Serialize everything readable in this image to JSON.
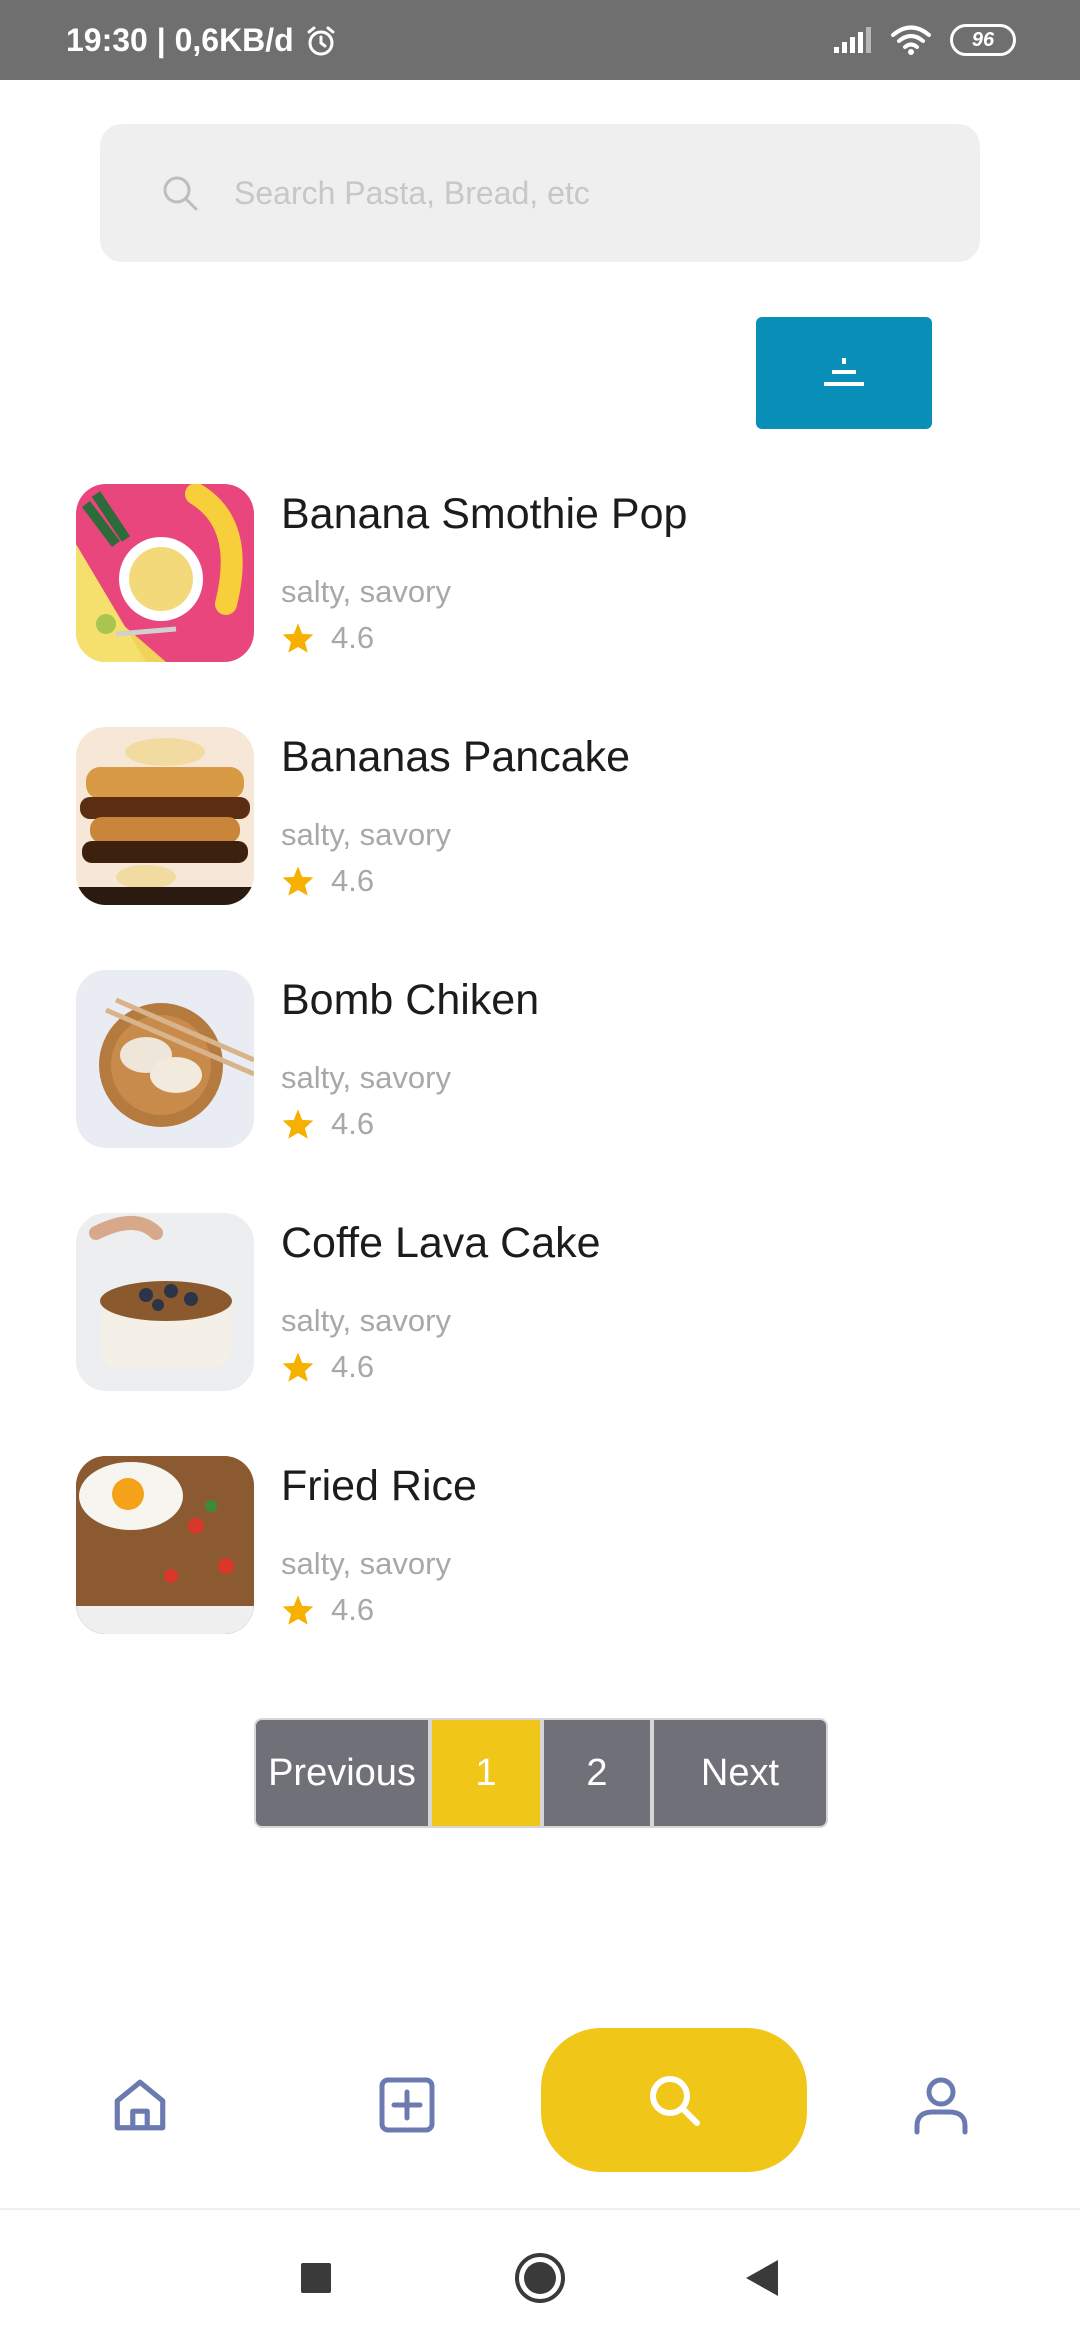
{
  "status_bar": {
    "time_speed": "19:30 | 0,6KB/d",
    "battery": "96"
  },
  "search": {
    "placeholder": "Search Pasta, Bread, etc"
  },
  "filter_button": {
    "icon": "filter-icon"
  },
  "foods": [
    {
      "title": "Banana Smothie Pop",
      "tags": "salty, savory",
      "rating": "4.6"
    },
    {
      "title": "Bananas Pancake",
      "tags": "salty, savory",
      "rating": "4.6"
    },
    {
      "title": "Bomb Chiken",
      "tags": "salty, savory",
      "rating": "4.6"
    },
    {
      "title": "Coffe Lava Cake",
      "tags": "salty, savory",
      "rating": "4.6"
    },
    {
      "title": "Fried Rice",
      "tags": "salty, savory",
      "rating": "4.6"
    }
  ],
  "pagination": {
    "previous": "Previous",
    "pages": [
      "1",
      "2"
    ],
    "next": "Next",
    "current": "1"
  },
  "bottom_nav": {
    "items": [
      "home-icon",
      "add-icon",
      "search-icon",
      "profile-icon"
    ],
    "active": "search-icon"
  },
  "colors": {
    "accent_yellow": "#f0c619",
    "filter_blue": "#0a8fb8",
    "page_gray": "#707079",
    "star": "#f5b000",
    "nav_icon": "#6b7bb0"
  }
}
